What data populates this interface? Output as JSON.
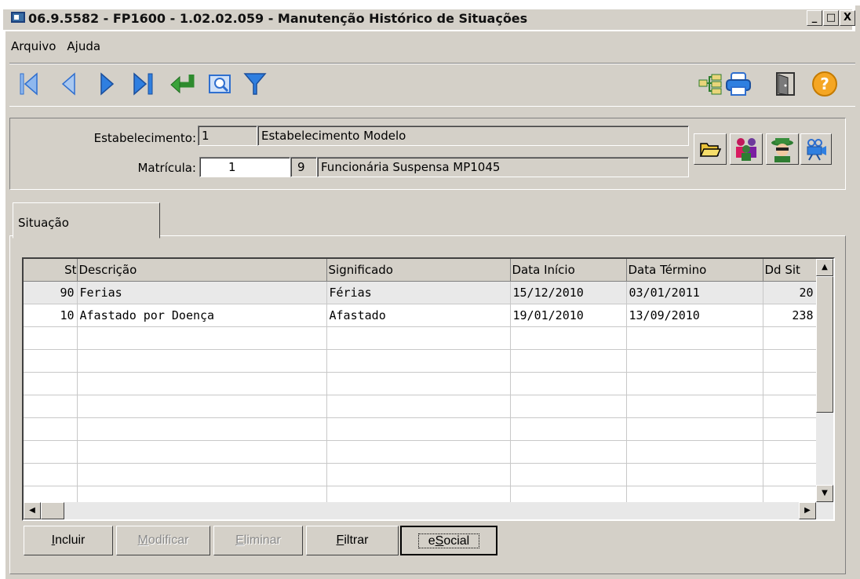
{
  "window": {
    "title": "06.9.5582 - FP1600 - 1.02.02.059 - Manutenção Histórico de Situações",
    "minimize": "_",
    "maximize": "□",
    "close": "X"
  },
  "menu": [
    "Arquivo",
    "Ajuda"
  ],
  "toolbar": {
    "left_icons": [
      "first-record-icon",
      "previous-record-icon",
      "next-record-icon",
      "last-record-icon",
      "return-icon",
      "zoom-icon",
      "filter-icon"
    ],
    "right_icons": [
      "tree-icon",
      "print-icon",
      "exit-door-icon",
      "help-icon"
    ]
  },
  "header": {
    "estab_label": "Estabelecimento:",
    "estab_code": "1",
    "estab_name": "Estabelecimento Modelo",
    "matricula_label": "Matrícula:",
    "matricula_code": "1",
    "matricula_digit": "9",
    "matricula_name": "Funcionária Suspensa MP1045"
  },
  "tab": {
    "label": "Situação"
  },
  "grid": {
    "columns": [
      "St",
      "Descrição",
      "Significado",
      "Data Início",
      "Data Término",
      "Dd Sit"
    ],
    "rows": [
      [
        "90",
        "Ferias",
        "Férias",
        "15/12/2010",
        "03/01/2011",
        "20"
      ],
      [
        "10",
        "Afastado por Doença",
        "Afastado",
        "19/01/2010",
        "13/09/2010",
        "238"
      ]
    ]
  },
  "buttons": {
    "incluir": {
      "u": "I",
      "rest": "ncluir"
    },
    "modificar": {
      "u": "M",
      "rest": "odificar"
    },
    "eliminar": {
      "u": "E",
      "rest": "liminar"
    },
    "filtrar": {
      "u": "F",
      "rest": "iltrar"
    },
    "esocial": {
      "pre": "e",
      "u": "S",
      "rest": "ocial"
    }
  },
  "colors": {
    "window_bg": "#d4d0c8",
    "nav_blue": "#2f7fe0",
    "accent_green": "#3aa33a"
  }
}
